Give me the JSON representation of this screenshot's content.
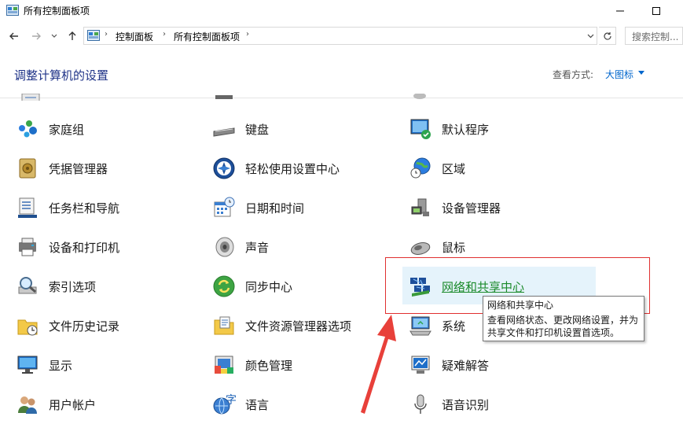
{
  "window": {
    "title": "所有控制面板项",
    "minimize_icon": "minimize-icon",
    "maximize_icon": "maximize-icon"
  },
  "navigation": {
    "back_icon": "arrow-left-icon",
    "forward_icon": "arrow-right-icon",
    "recent_icon": "chevron-down-icon",
    "up_icon": "arrow-up-icon",
    "breadcrumbs": [
      "控制面板",
      "所有控制面板项"
    ],
    "search_placeholder": "搜索控制..."
  },
  "header": {
    "title": "调整计算机的设置",
    "view_label": "查看方式:",
    "view_value": "大图标"
  },
  "items": {
    "col1": [
      "家庭组",
      "凭据管理器",
      "任务栏和导航",
      "设备和打印机",
      "索引选项",
      "文件历史记录",
      "显示",
      "用户帐户"
    ],
    "col2": [
      "键盘",
      "轻松使用设置中心",
      "日期和时间",
      "声音",
      "同步中心",
      "文件资源管理器选项",
      "颜色管理",
      "语言"
    ],
    "col3": [
      "默认程序",
      "区域",
      "设备管理器",
      "鼠标",
      "网络和共享中心",
      "系统",
      "疑难解答",
      "语音识别"
    ]
  },
  "tooltip": {
    "title": "网络和共享中心",
    "description_line1": "查看网络状态、更改网络设置，并为",
    "description_line2": "共享文件和打印机设置首选项。"
  },
  "colors": {
    "heading": "#1e3287",
    "link": "#0066cc",
    "hover_bg": "#e5f3fb",
    "annotation_red": "#e03030"
  }
}
